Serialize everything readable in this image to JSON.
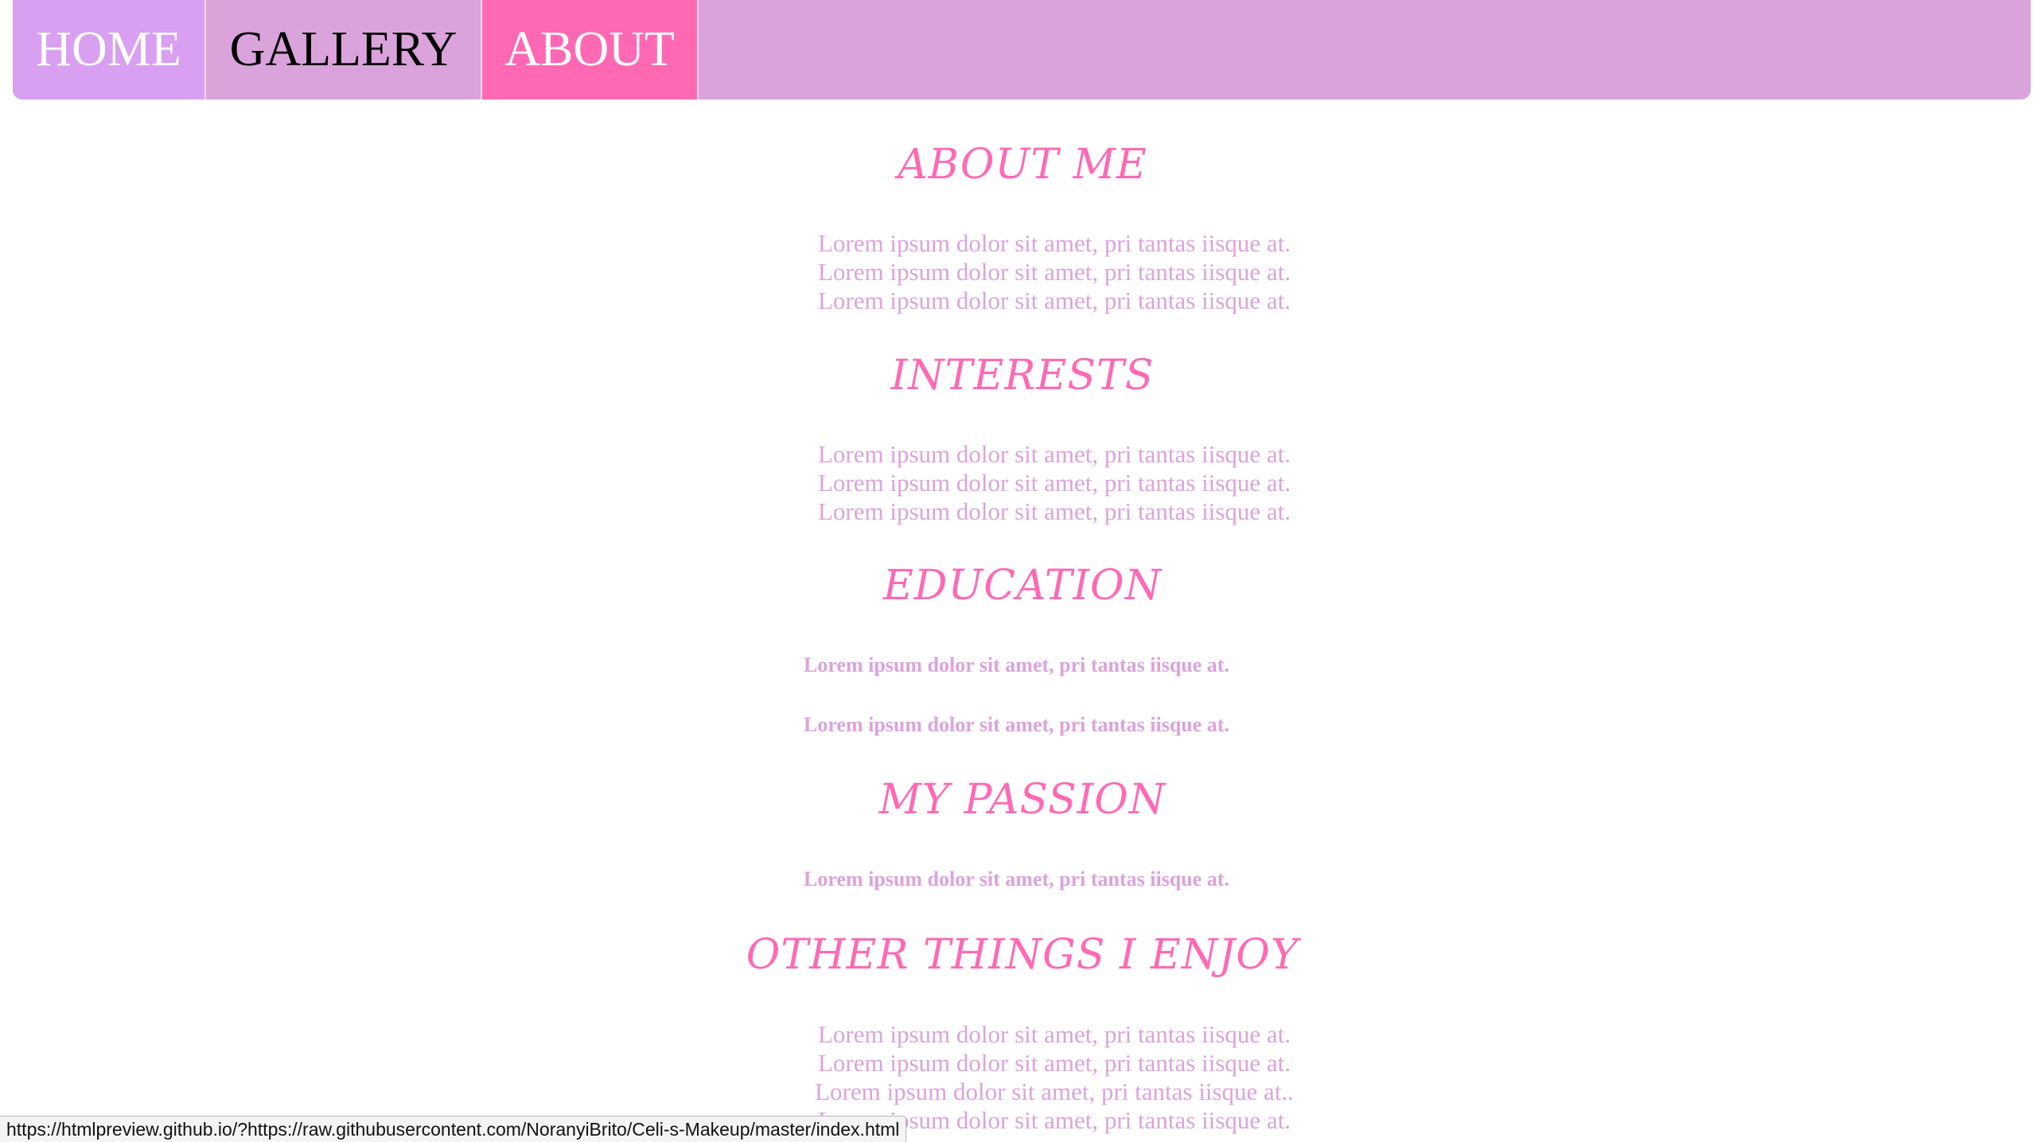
{
  "nav": {
    "home": "HOME",
    "gallery": "GALLERY",
    "about": "ABOUT"
  },
  "sections": {
    "about_me": {
      "title": "ABOUT ME",
      "lines": [
        "Lorem ipsum dolor sit amet, pri tantas iisque at.",
        "Lorem ipsum dolor sit amet, pri tantas iisque at.",
        "Lorem ipsum dolor sit amet, pri tantas iisque at."
      ]
    },
    "interests": {
      "title": "INTERESTS",
      "lines": [
        "Lorem ipsum dolor sit amet, pri tantas iisque at.",
        "Lorem ipsum dolor sit amet, pri tantas iisque at.",
        "Lorem ipsum dolor sit amet, pri tantas iisque at."
      ]
    },
    "education": {
      "title": "EDUCATION",
      "lines": [
        "Lorem ipsum dolor sit amet, pri tantas iisque at.",
        "Lorem ipsum dolor sit amet, pri tantas iisque at."
      ]
    },
    "my_passion": {
      "title": "MY PASSION",
      "lines": [
        "Lorem ipsum dolor sit amet, pri tantas iisque at."
      ]
    },
    "other_things": {
      "title": "OTHER THINGS I ENJOY",
      "lines": [
        "Lorem ipsum dolor sit amet, pri tantas iisque at.",
        "Lorem ipsum dolor sit amet, pri tantas iisque at.",
        "Lorem ipsum dolor sit amet, pri tantas iisque at..",
        "Lorem ipsum dolor sit amet, pri tantas iisque at."
      ]
    }
  },
  "status_bar": {
    "url": "https://htmlpreview.github.io/?https://raw.githubusercontent.com/NoranyiBrito/Celi-s-Makeup/master/index.html"
  },
  "colors": {
    "navbar": "#dba3dc",
    "home_tab": "#d99ff0",
    "active_tab": "#ff69b4",
    "heading": "#ff69b4",
    "body_text": "#dba3dc"
  }
}
